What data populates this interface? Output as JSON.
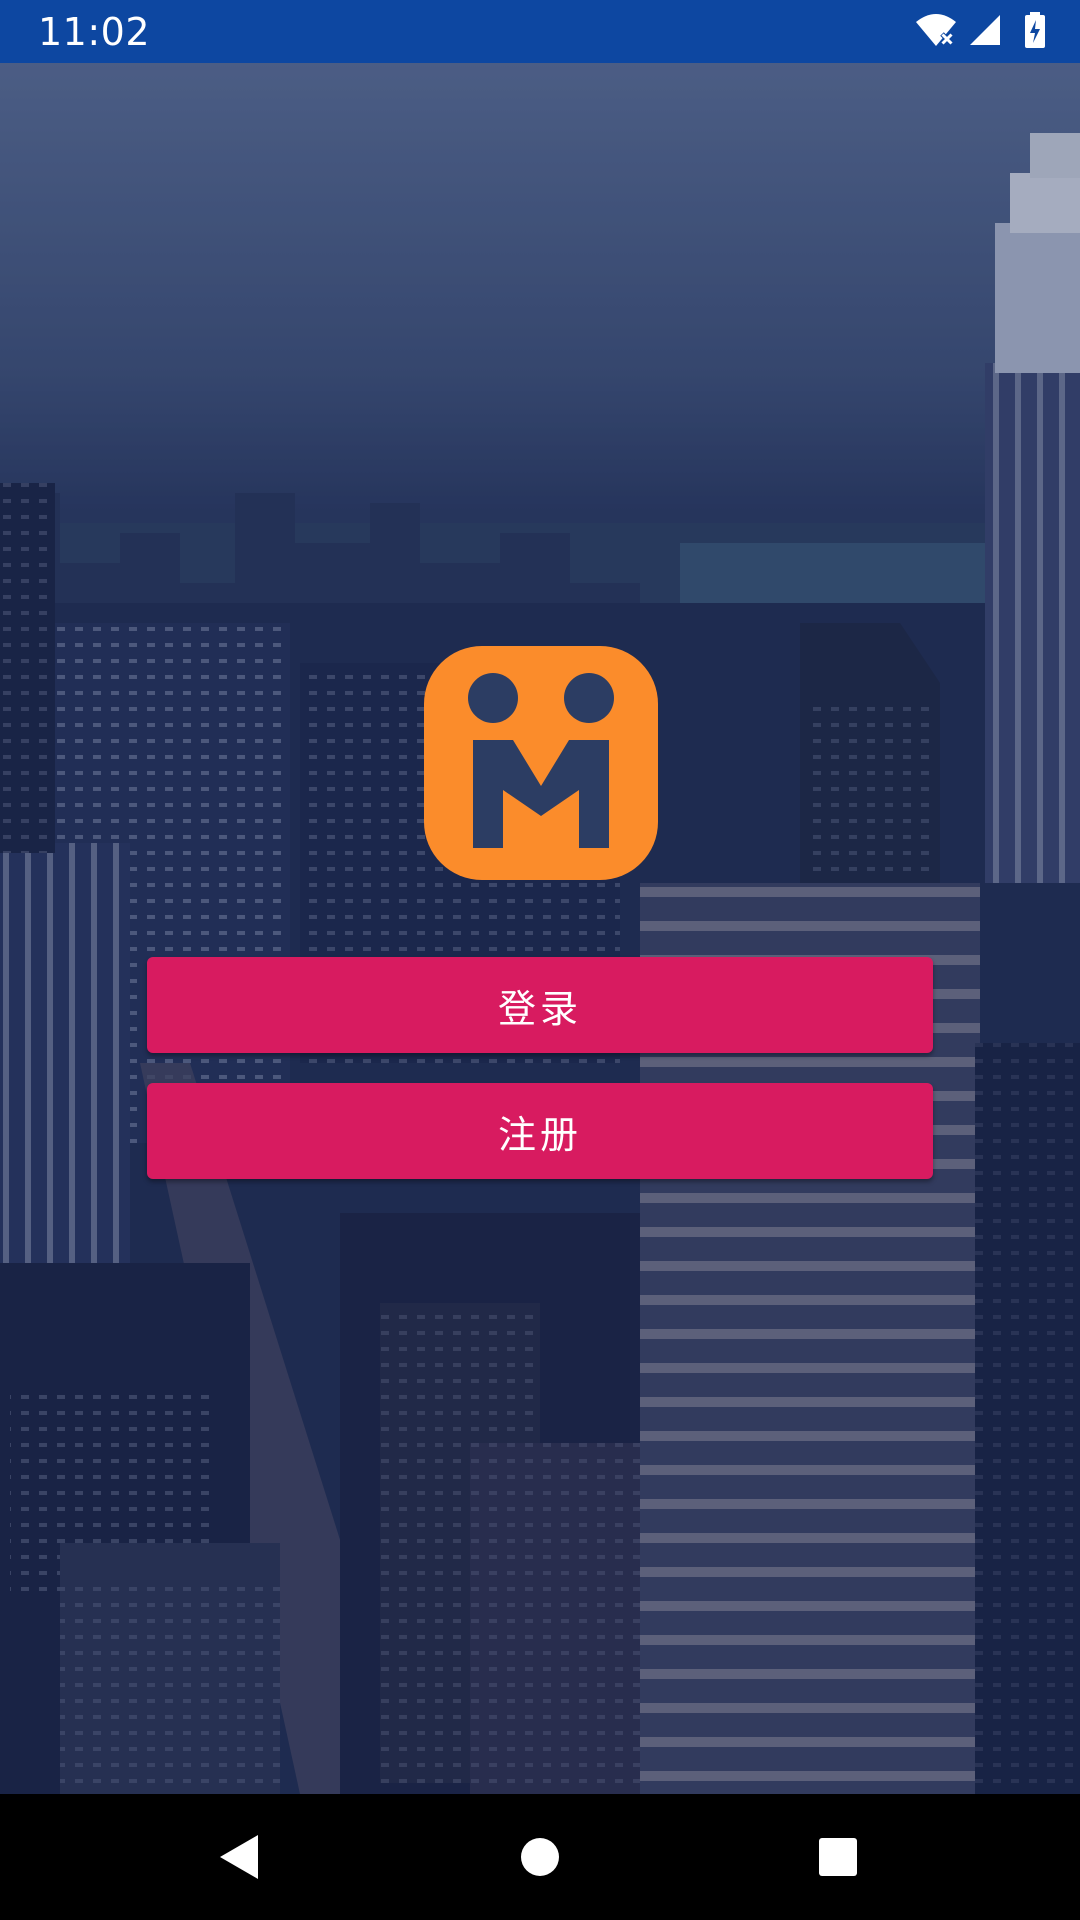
{
  "status_bar": {
    "time": "11:02",
    "icons": [
      "wifi-off-icon",
      "signal-icon",
      "battery-charging-icon"
    ],
    "background": "#0d47a1"
  },
  "logo": {
    "icon": "app-logo-m-icon",
    "color": "#fb8c2b"
  },
  "actions": {
    "login_label": "登录",
    "register_label": "注册",
    "button_color": "#d81b60"
  },
  "nav_bar": {
    "icons": [
      "back-icon",
      "home-icon",
      "recents-icon"
    ]
  }
}
